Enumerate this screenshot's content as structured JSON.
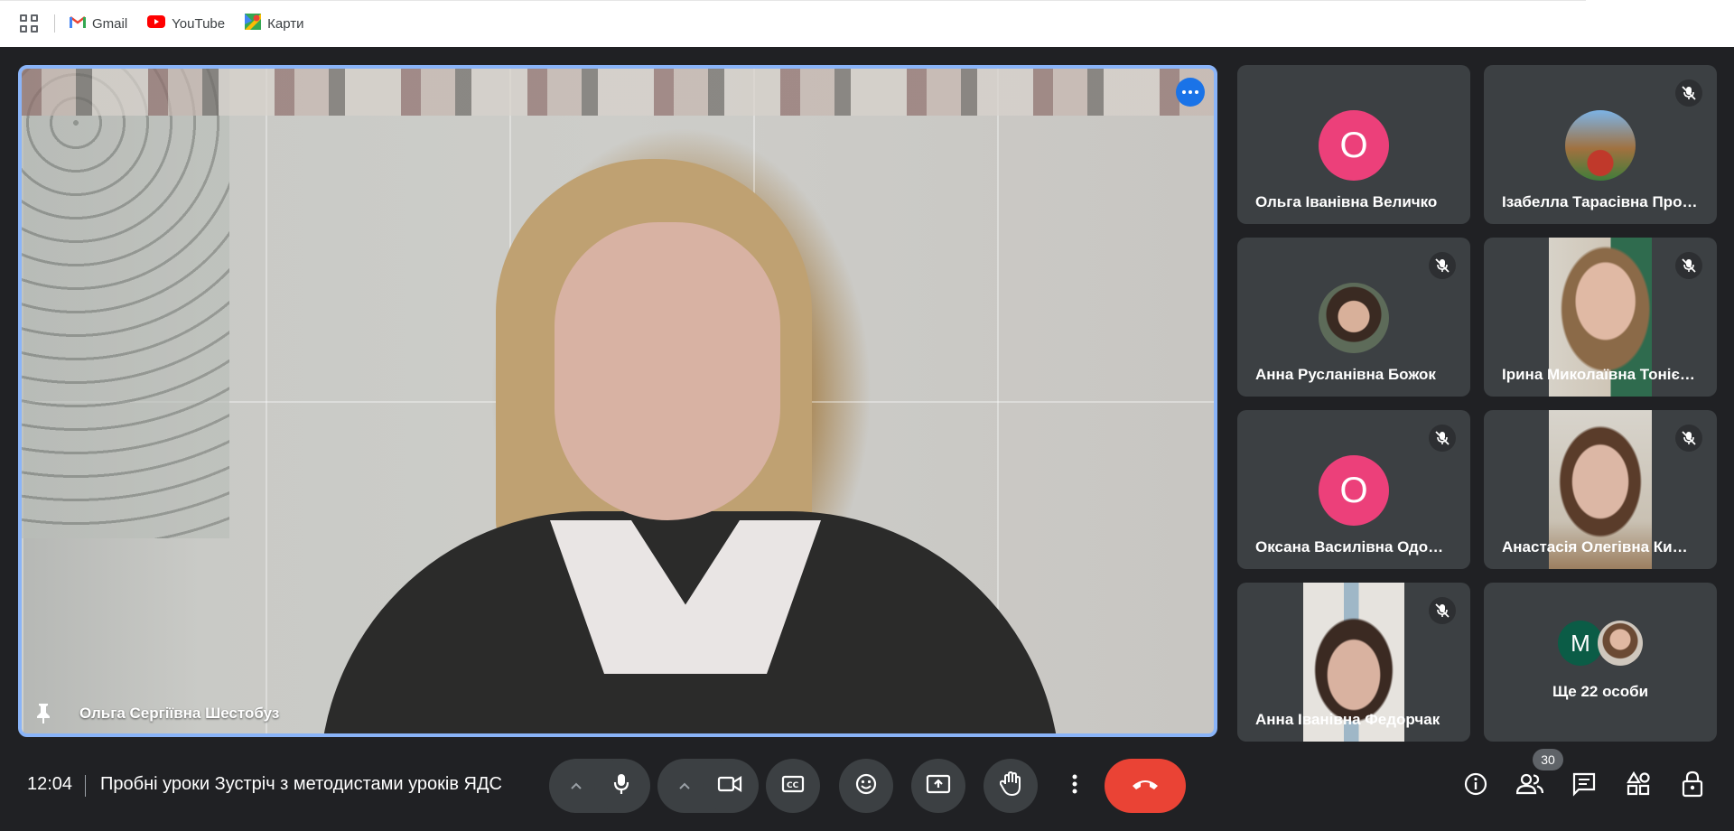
{
  "bookmarks": [
    {
      "label": "Gmail",
      "icon": "gmail-icon"
    },
    {
      "label": "YouTube",
      "icon": "youtube-icon"
    },
    {
      "label": "Карти",
      "icon": "maps-icon"
    }
  ],
  "main_speaker": {
    "name": "Ольга Сергіївна Шестобуз"
  },
  "participants": [
    {
      "name": "Ольга Іванівна Величко",
      "avatar_letter": "О",
      "muted": false
    },
    {
      "name": "Ізабелла Тарасівна Про…",
      "muted": true
    },
    {
      "name": "Анна Русланівна Божок",
      "muted": true
    },
    {
      "name": "Ірина Миколаївна Тоніє…",
      "muted": true
    },
    {
      "name": "Оксана Василівна Одов…",
      "avatar_letter": "О",
      "muted": true
    },
    {
      "name": "Анастасія Олегівна Ки…",
      "muted": true
    },
    {
      "name": "Анна Іванівна Федорчак",
      "muted": true
    }
  ],
  "others_tile": {
    "label": "Ще 22 особи",
    "avatar_letter": "M"
  },
  "footer": {
    "time": "12:04",
    "meeting_title": "Пробні уроки Зустріч з методистами уроків ЯДС",
    "participant_count": "30"
  },
  "colors": {
    "accent": "#8ab4f8",
    "end_call": "#ea4335",
    "avatar_pink": "#ec407a",
    "avatar_green": "#0b5c46",
    "tile_bg": "#3c4043"
  }
}
